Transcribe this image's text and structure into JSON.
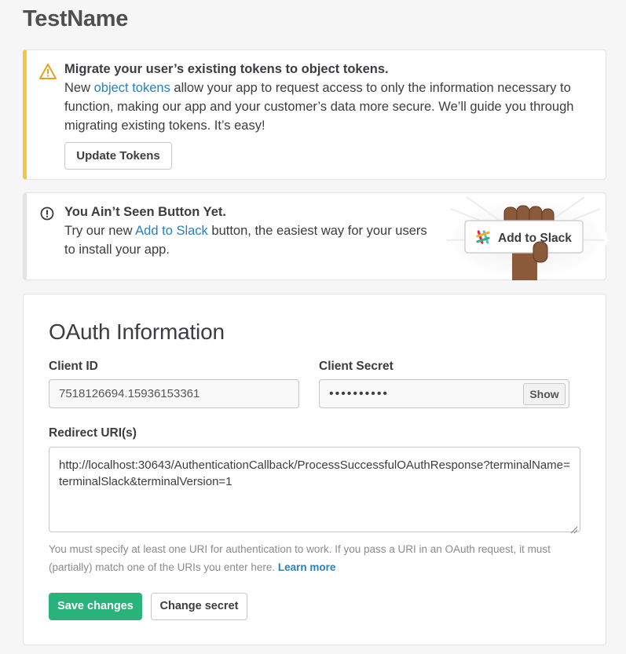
{
  "page": {
    "title": "TestName"
  },
  "migrate_alert": {
    "icon": "warning-icon",
    "title": "Migrate your user’s existing tokens to object tokens.",
    "text_before_link": "New ",
    "link": "object tokens",
    "text_after_link": " allow your app to request access to only the information necessary to function, making our app and your customer’s data more secure. We’ll guide you through migrating existing tokens. It’s easy!",
    "button": "Update Tokens",
    "accent_color": "#f2c744"
  },
  "button_alert": {
    "icon": "info-icon",
    "title": "You Ain’t Seen Button Yet.",
    "text_before_link": "Try our new ",
    "link": "Add to Slack",
    "text_after_link": " button, the easiest way for your users to install your app.",
    "art_button": "Add to Slack"
  },
  "oauth": {
    "title": "OAuth Information",
    "client_id_label": "Client ID",
    "client_id_value": "7518126694.15936153361",
    "client_secret_label": "Client Secret",
    "client_secret_value": "••••••••••",
    "show_button": "Show",
    "redirect_label": "Redirect URI(s)",
    "redirect_value": "http://localhost:30643/AuthenticationCallback/ProcessSuccessfulOAuthResponse?terminalName=terminalSlack&terminalVersion=1",
    "help_text": "You must specify at least one URI for authentication to work. If you pass a URI in an OAuth request, it must (partially) match one of the URIs you enter here. ",
    "learn_more": "Learn more",
    "save_button": "Save changes",
    "change_secret_button": "Change secret",
    "save_color": "#2ab27b",
    "link_color": "#2a80b9"
  }
}
